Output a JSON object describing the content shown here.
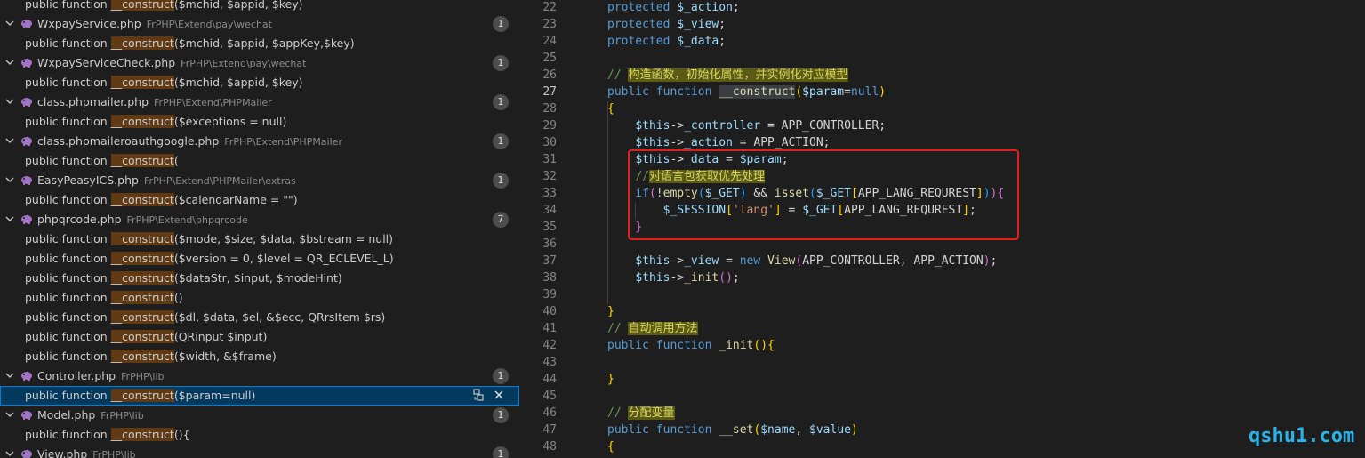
{
  "search_results": {
    "top_partial": {
      "prefix": "public function ",
      "match": "__construct",
      "suffix": "($mchid, $appid, $key)"
    },
    "groups": [
      {
        "file": "WxpayService.php",
        "path": "FrPHP\\Extend\\pay\\wechat",
        "count": "1",
        "matches": [
          {
            "prefix": "public function ",
            "match": "__construct",
            "suffix": "($mchid, $appid, $appKey,$key)"
          }
        ]
      },
      {
        "file": "WxpayServiceCheck.php",
        "path": "FrPHP\\Extend\\pay\\wechat",
        "count": "1",
        "matches": [
          {
            "prefix": "public function ",
            "match": "__construct",
            "suffix": "($mchid, $appid, $key)"
          }
        ]
      },
      {
        "file": "class.phpmailer.php",
        "path": "FrPHP\\Extend\\PHPMailer",
        "count": "1",
        "matches": [
          {
            "prefix": "public function ",
            "match": "__construct",
            "suffix": "($exceptions = null)"
          }
        ]
      },
      {
        "file": "class.phpmaileroauthgoogle.php",
        "path": "FrPHP\\Extend\\PHPMailer",
        "count": "1",
        "matches": [
          {
            "prefix": "public function ",
            "match": "__construct",
            "suffix": "("
          }
        ]
      },
      {
        "file": "EasyPeasyICS.php",
        "path": "FrPHP\\Extend\\PHPMailer\\extras",
        "count": "1",
        "matches": [
          {
            "prefix": "public function ",
            "match": "__construct",
            "suffix": "($calendarName = \"\")"
          }
        ]
      },
      {
        "file": "phpqrcode.php",
        "path": "FrPHP\\Extend\\phpqrcode",
        "count": "7",
        "matches": [
          {
            "prefix": "public function ",
            "match": "__construct",
            "suffix": "($mode, $size, $data, $bstream = null)"
          },
          {
            "prefix": "public function ",
            "match": "__construct",
            "suffix": "($version = 0, $level = QR_ECLEVEL_L)"
          },
          {
            "prefix": "public function ",
            "match": "__construct",
            "suffix": "($dataStr, $input, $modeHint)"
          },
          {
            "prefix": "public function ",
            "match": "__construct",
            "suffix": "()"
          },
          {
            "prefix": "public function ",
            "match": "__construct",
            "suffix": "($dl, $data, $el, &$ecc, QRrsItem $rs)"
          },
          {
            "prefix": "public function ",
            "match": "__construct",
            "suffix": "(QRinput $input)"
          },
          {
            "prefix": "public function ",
            "match": "__construct",
            "suffix": "($width, &$frame)"
          }
        ]
      },
      {
        "file": "Controller.php",
        "path": "FrPHP\\lib",
        "count": "1",
        "matches": [
          {
            "prefix": "public function ",
            "match": "__construct",
            "suffix": "($param=null)",
            "selected": true
          }
        ]
      },
      {
        "file": "Model.php",
        "path": "FrPHP\\lib",
        "count": "1",
        "matches": [
          {
            "prefix": "public function ",
            "match": "__construct",
            "suffix": "(){"
          }
        ]
      },
      {
        "file": "View.php",
        "path": "FrPHP\\lib",
        "count": "1",
        "matches": []
      }
    ]
  },
  "editor": {
    "current_line": "27",
    "lines": [
      {
        "n": "22",
        "t": [
          [
            "kw",
            "protected"
          ],
          [
            "p",
            " "
          ],
          [
            "var",
            "$_action"
          ],
          [
            "p",
            ";"
          ]
        ]
      },
      {
        "n": "23",
        "t": [
          [
            "kw",
            "protected"
          ],
          [
            "p",
            " "
          ],
          [
            "var",
            "$_view"
          ],
          [
            "p",
            ";"
          ]
        ]
      },
      {
        "n": "24",
        "t": [
          [
            "kw",
            "protected"
          ],
          [
            "p",
            " "
          ],
          [
            "var",
            "$_data"
          ],
          [
            "p",
            ";"
          ]
        ]
      },
      {
        "n": "25",
        "t": []
      },
      {
        "n": "26",
        "t": [
          [
            "cmt",
            "// "
          ],
          [
            "cmtbg",
            "构造函数，初始化属性，并实例化对应模型"
          ]
        ]
      },
      {
        "n": "27",
        "t": [
          [
            "kw",
            "public"
          ],
          [
            "p",
            " "
          ],
          [
            "kw",
            "function"
          ],
          [
            "p",
            " "
          ],
          [
            "fnsel",
            "__construct"
          ],
          [
            "brk1",
            "("
          ],
          [
            "var",
            "$param"
          ],
          [
            "p",
            "="
          ],
          [
            "kw",
            "null"
          ],
          [
            "brk1",
            ")"
          ]
        ]
      },
      {
        "n": "28",
        "t": [
          [
            "brk1",
            "{"
          ]
        ]
      },
      {
        "n": "29",
        "t": [
          [
            "p",
            "    "
          ],
          [
            "var",
            "$this"
          ],
          [
            "p",
            "->"
          ],
          [
            "var",
            "_controller"
          ],
          [
            "p",
            " = APP_CONTROLLER;"
          ]
        ]
      },
      {
        "n": "30",
        "t": [
          [
            "p",
            "    "
          ],
          [
            "var",
            "$this"
          ],
          [
            "p",
            "->"
          ],
          [
            "var",
            "_action"
          ],
          [
            "p",
            " = APP_ACTION;"
          ]
        ]
      },
      {
        "n": "31",
        "t": [
          [
            "p",
            "    "
          ],
          [
            "var",
            "$this"
          ],
          [
            "p",
            "->"
          ],
          [
            "var",
            "_data"
          ],
          [
            "p",
            " = "
          ],
          [
            "var",
            "$param"
          ],
          [
            "p",
            ";"
          ]
        ]
      },
      {
        "n": "32",
        "t": [
          [
            "p",
            "    "
          ],
          [
            "cmt",
            "//"
          ],
          [
            "cmtbg",
            "对语言包获取优先处理"
          ]
        ]
      },
      {
        "n": "33",
        "t": [
          [
            "p",
            "    "
          ],
          [
            "kw",
            "if"
          ],
          [
            "brk2",
            "("
          ],
          [
            "p",
            "!"
          ],
          [
            "fn",
            "empty"
          ],
          [
            "brk3",
            "("
          ],
          [
            "var",
            "$_GET"
          ],
          [
            "brk3",
            ")"
          ],
          [
            "p",
            " && "
          ],
          [
            "fn",
            "isset"
          ],
          [
            "brk3",
            "("
          ],
          [
            "var",
            "$_GET"
          ],
          [
            "brk1",
            "["
          ],
          [
            "p",
            "APP_LANG_REQUREST"
          ],
          [
            "brk1",
            "]"
          ],
          [
            "brk3",
            ")"
          ],
          [
            "brk2",
            ")"
          ],
          [
            "brk2",
            "{"
          ]
        ]
      },
      {
        "n": "34",
        "t": [
          [
            "p",
            "        "
          ],
          [
            "var",
            "$_SESSION"
          ],
          [
            "brk1",
            "["
          ],
          [
            "str",
            "'lang'"
          ],
          [
            "brk1",
            "]"
          ],
          [
            "p",
            " = "
          ],
          [
            "var",
            "$_GET"
          ],
          [
            "brk1",
            "["
          ],
          [
            "p",
            "APP_LANG_REQUREST"
          ],
          [
            "brk1",
            "]"
          ],
          [
            "p",
            ";"
          ]
        ]
      },
      {
        "n": "35",
        "t": [
          [
            "p",
            "    "
          ],
          [
            "brk2",
            "}"
          ]
        ]
      },
      {
        "n": "36",
        "t": []
      },
      {
        "n": "37",
        "t": [
          [
            "p",
            "    "
          ],
          [
            "var",
            "$this"
          ],
          [
            "p",
            "->"
          ],
          [
            "var",
            "_view"
          ],
          [
            "p",
            " = "
          ],
          [
            "kw",
            "new"
          ],
          [
            "p",
            " "
          ],
          [
            "fn",
            "View"
          ],
          [
            "brk2",
            "("
          ],
          [
            "p",
            "APP_CONTROLLER, APP_ACTION"
          ],
          [
            "brk2",
            ")"
          ],
          [
            "p",
            ";"
          ]
        ]
      },
      {
        "n": "38",
        "t": [
          [
            "p",
            "    "
          ],
          [
            "var",
            "$this"
          ],
          [
            "p",
            "->"
          ],
          [
            "fn",
            "_init"
          ],
          [
            "brk2",
            "()"
          ],
          [
            "p",
            ";"
          ]
        ]
      },
      {
        "n": "39",
        "t": []
      },
      {
        "n": "40",
        "t": [
          [
            "brk1",
            "}"
          ]
        ]
      },
      {
        "n": "41",
        "t": [
          [
            "cmt",
            "// "
          ],
          [
            "cmtbg",
            "自动调用方法"
          ]
        ]
      },
      {
        "n": "42",
        "t": [
          [
            "kw",
            "public"
          ],
          [
            "p",
            " "
          ],
          [
            "kw",
            "function"
          ],
          [
            "p",
            " "
          ],
          [
            "fn",
            "_init"
          ],
          [
            "brk1",
            "()"
          ],
          [
            "brk1",
            "{"
          ]
        ]
      },
      {
        "n": "43",
        "t": []
      },
      {
        "n": "44",
        "t": [
          [
            "brk1",
            "}"
          ]
        ]
      },
      {
        "n": "45",
        "t": []
      },
      {
        "n": "46",
        "t": [
          [
            "cmt",
            "// "
          ],
          [
            "cmtbg",
            "分配变量"
          ]
        ]
      },
      {
        "n": "47",
        "t": [
          [
            "kw",
            "public"
          ],
          [
            "p",
            " "
          ],
          [
            "kw",
            "function"
          ],
          [
            "p",
            " "
          ],
          [
            "fn",
            "__set"
          ],
          [
            "brk1",
            "("
          ],
          [
            "var",
            "$name"
          ],
          [
            "p",
            ", "
          ],
          [
            "var",
            "$value"
          ],
          [
            "brk1",
            ")"
          ]
        ]
      },
      {
        "n": "48",
        "t": [
          [
            "brk1",
            "{"
          ]
        ]
      }
    ]
  },
  "watermark": "qshu1.com",
  "colors": {
    "match_highlight": "#613a13",
    "selection": "#04395e",
    "annotation_box": "#e0201e",
    "watermark": "#2ab3e8"
  }
}
